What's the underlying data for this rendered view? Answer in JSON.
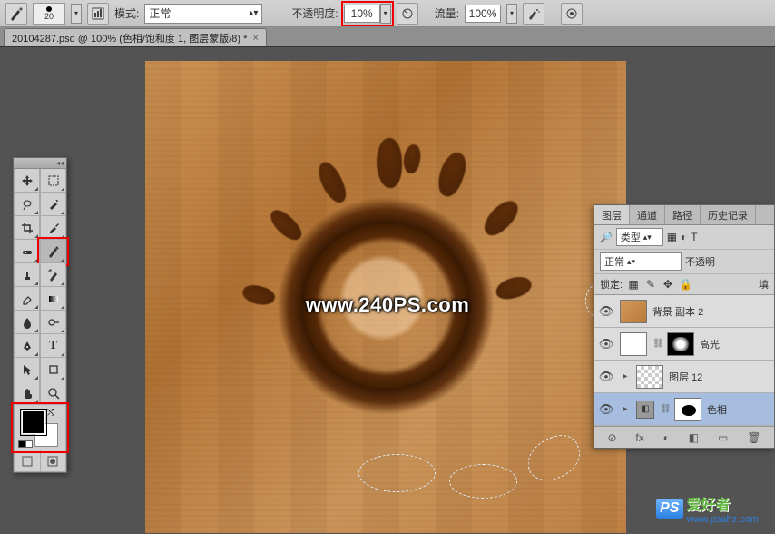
{
  "optbar": {
    "brush_size": "20",
    "mode_label": "模式:",
    "mode_value": "正常",
    "opacity_label": "不透明度:",
    "opacity_value": "10%",
    "flow_label": "流量:",
    "flow_value": "100%"
  },
  "tab": {
    "title": "20104287.psd @ 100% (色相/饱和度 1, 图层蒙版/8) *",
    "close": "×"
  },
  "watermark": {
    "center": "www.240PS.com",
    "corner_brand": "PS",
    "corner_text": "爱好者",
    "corner_url": "www.psahz.com"
  },
  "tools": {
    "collapse": "◂◂"
  },
  "layers": {
    "tabs": [
      "图层",
      "通道",
      "路径",
      "历史记录"
    ],
    "kind_label": "类型",
    "blend_value": "正常",
    "opacity_short": "不透明",
    "lock_label": "锁定:",
    "fill_short": "填",
    "items": [
      {
        "name": "背景 副本 2"
      },
      {
        "name": "高光"
      },
      {
        "name": "图层 12"
      },
      {
        "name": "色相"
      }
    ],
    "footer_icons": [
      "⊘",
      "fx",
      "◐",
      "◧",
      "▭",
      "🗑"
    ]
  }
}
